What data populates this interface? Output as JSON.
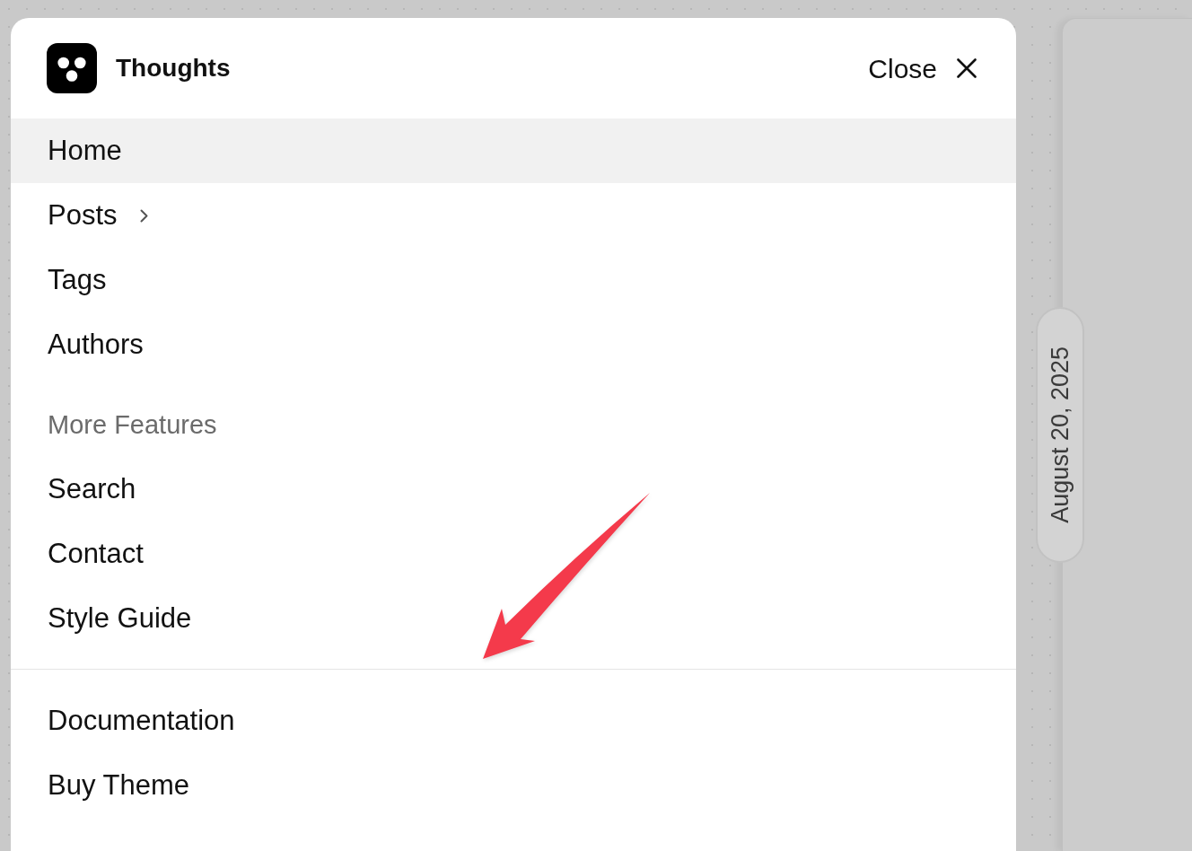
{
  "header": {
    "brand": "Thoughts",
    "close_label": "Close"
  },
  "primary_nav": [
    {
      "label": "Home",
      "selected": true,
      "expandable": false
    },
    {
      "label": "Posts",
      "selected": false,
      "expandable": true
    },
    {
      "label": "Tags",
      "selected": false,
      "expandable": false
    },
    {
      "label": "Authors",
      "selected": false,
      "expandable": false
    }
  ],
  "more_features": {
    "heading": "More Features",
    "items": [
      {
        "label": "Search",
        "selected": false
      },
      {
        "label": "Contact",
        "selected": false
      },
      {
        "label": "Style Guide",
        "selected": false
      }
    ]
  },
  "footer_links": [
    {
      "label": "Documentation",
      "selected": false
    },
    {
      "label": "Buy Theme",
      "selected": false
    }
  ],
  "date_badge": "August 20, 2025"
}
